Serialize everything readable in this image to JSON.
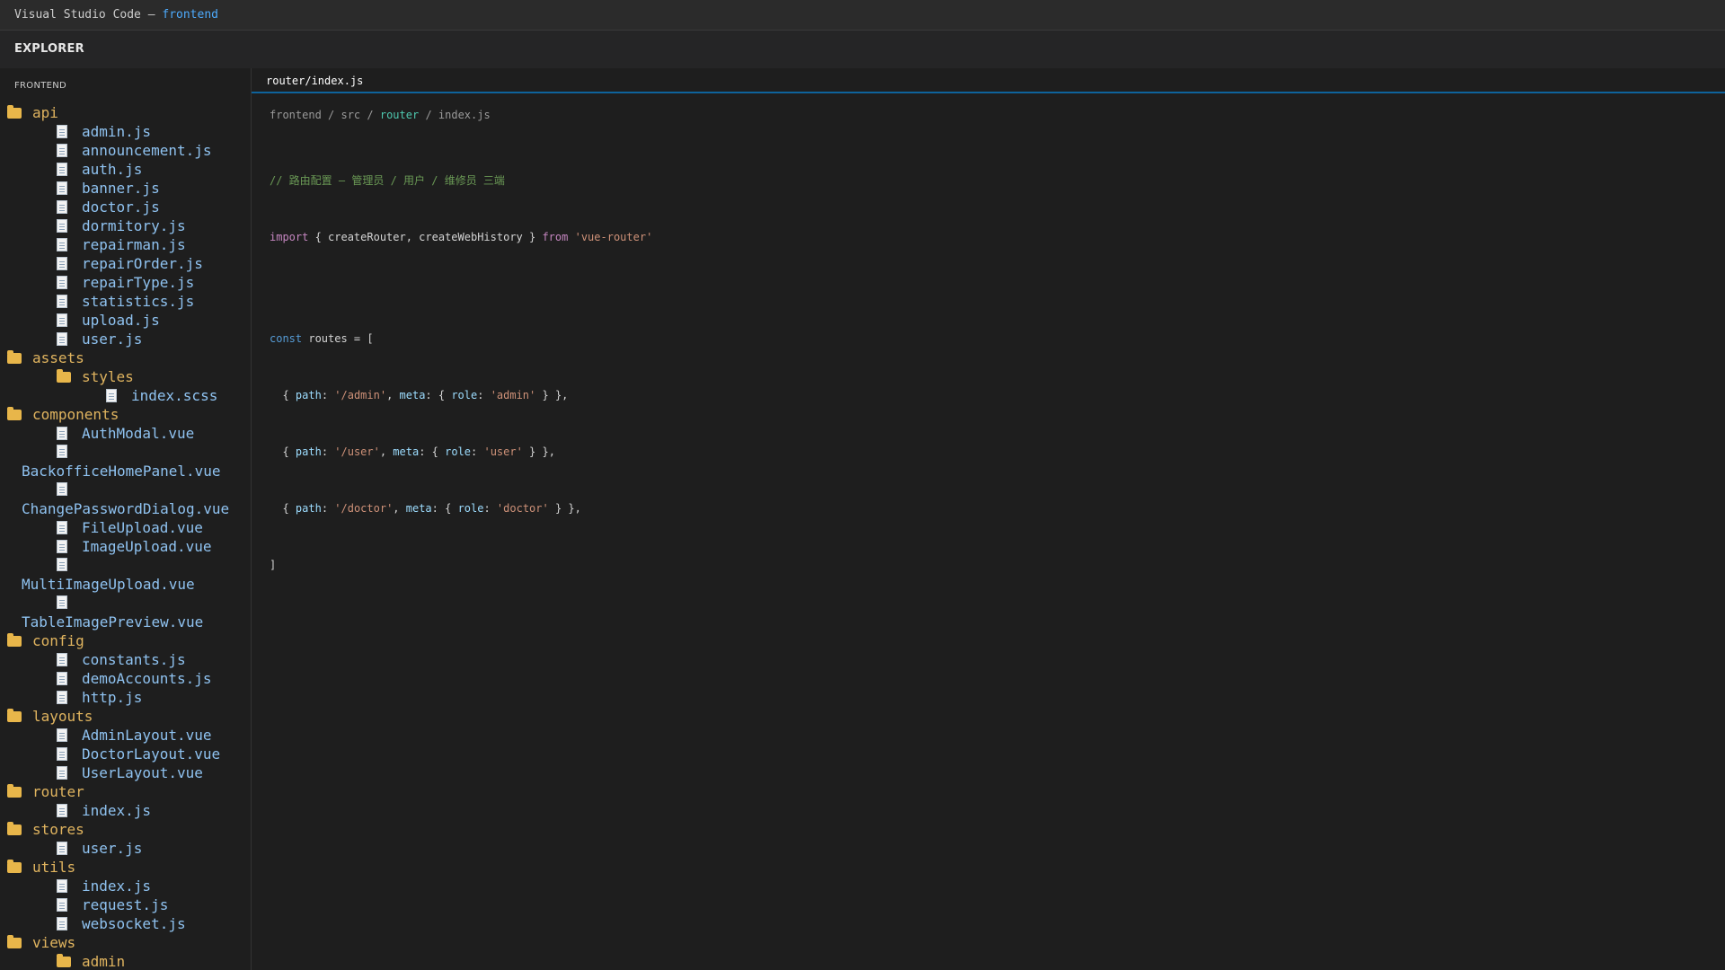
{
  "window": {
    "title_prefix": "Visual Studio Code — ",
    "project": "frontend"
  },
  "explorer": {
    "header": "EXPLORER",
    "section": "FRONTEND",
    "tree": [
      {
        "type": "folder",
        "name": "api",
        "depth": 0
      },
      {
        "type": "file",
        "name": "admin.js",
        "depth": 1
      },
      {
        "type": "file",
        "name": "announcement.js",
        "depth": 1
      },
      {
        "type": "file",
        "name": "auth.js",
        "depth": 1
      },
      {
        "type": "file",
        "name": "banner.js",
        "depth": 1
      },
      {
        "type": "file",
        "name": "doctor.js",
        "depth": 1
      },
      {
        "type": "file",
        "name": "dormitory.js",
        "depth": 1
      },
      {
        "type": "file",
        "name": "repairman.js",
        "depth": 1
      },
      {
        "type": "file",
        "name": "repairOrder.js",
        "depth": 1
      },
      {
        "type": "file",
        "name": "repairType.js",
        "depth": 1
      },
      {
        "type": "file",
        "name": "statistics.js",
        "depth": 1
      },
      {
        "type": "file",
        "name": "upload.js",
        "depth": 1
      },
      {
        "type": "file",
        "name": "user.js",
        "depth": 1
      },
      {
        "type": "folder",
        "name": "assets",
        "depth": 0
      },
      {
        "type": "folder",
        "name": "styles",
        "depth": 1
      },
      {
        "type": "file",
        "name": "index.scss",
        "depth": 2
      },
      {
        "type": "folder",
        "name": "components",
        "depth": 0
      },
      {
        "type": "file",
        "name": "AuthModal.vue",
        "depth": 1
      },
      {
        "type": "file",
        "name": "BackofficeHomePanel.vue",
        "depth": 1,
        "wrap": true
      },
      {
        "type": "file",
        "name": "ChangePasswordDialog.vue",
        "depth": 1,
        "wrap": true
      },
      {
        "type": "file",
        "name": "FileUpload.vue",
        "depth": 1
      },
      {
        "type": "file",
        "name": "ImageUpload.vue",
        "depth": 1
      },
      {
        "type": "file",
        "name": "MultiImageUpload.vue",
        "depth": 1,
        "wrap": true
      },
      {
        "type": "file",
        "name": "TableImagePreview.vue",
        "depth": 1,
        "wrap": true
      },
      {
        "type": "folder",
        "name": "config",
        "depth": 0
      },
      {
        "type": "file",
        "name": "constants.js",
        "depth": 1
      },
      {
        "type": "file",
        "name": "demoAccounts.js",
        "depth": 1
      },
      {
        "type": "file",
        "name": "http.js",
        "depth": 1
      },
      {
        "type": "folder",
        "name": "layouts",
        "depth": 0
      },
      {
        "type": "file",
        "name": "AdminLayout.vue",
        "depth": 1
      },
      {
        "type": "file",
        "name": "DoctorLayout.vue",
        "depth": 1
      },
      {
        "type": "file",
        "name": "UserLayout.vue",
        "depth": 1
      },
      {
        "type": "folder",
        "name": "router",
        "depth": 0
      },
      {
        "type": "file",
        "name": "index.js",
        "depth": 1
      },
      {
        "type": "folder",
        "name": "stores",
        "depth": 0
      },
      {
        "type": "file",
        "name": "user.js",
        "depth": 1
      },
      {
        "type": "folder",
        "name": "utils",
        "depth": 0
      },
      {
        "type": "file",
        "name": "index.js",
        "depth": 1
      },
      {
        "type": "file",
        "name": "request.js",
        "depth": 1
      },
      {
        "type": "file",
        "name": "websocket.js",
        "depth": 1
      },
      {
        "type": "folder",
        "name": "views",
        "depth": 0
      },
      {
        "type": "folder",
        "name": "admin",
        "depth": 1
      }
    ]
  },
  "editor": {
    "tab": "router/index.js",
    "breadcrumb": [
      "frontend",
      "src",
      "router",
      "index.js"
    ],
    "breadcrumb_sep": " / ",
    "code": {
      "comment": "// 路由配置 — 管理员 / 用户 / 维修员 三端",
      "import_kw": "import",
      "import_body": " { createRouter, createWebHistory } ",
      "from_kw": "from",
      "import_src": "'vue-router'",
      "const_kw": "const",
      "const_body": " routes = [",
      "routes": [
        {
          "path": "'/admin'",
          "role": "'admin'"
        },
        {
          "path": "'/user'",
          "role": "'user'"
        },
        {
          "path": "'/doctor'",
          "role": "'doctor'"
        }
      ],
      "close": "]"
    }
  },
  "colors": {
    "folder": "#e0b45f",
    "file": "#8fc2f0",
    "accent": "#4daafc",
    "comment": "#6a9955",
    "string": "#ce9178",
    "keyword": "#c586c0"
  },
  "icons": {
    "folder": "folder-icon",
    "file": "file-icon"
  }
}
